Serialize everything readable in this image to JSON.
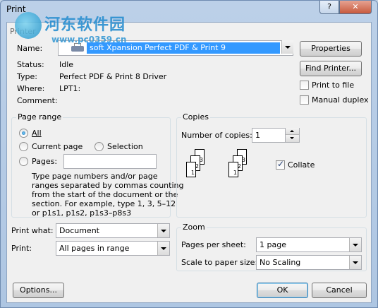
{
  "window": {
    "title": "Print",
    "help": "?",
    "close": "✕"
  },
  "watermark": {
    "title": "河东软件园",
    "url": "www.pc0359.cn"
  },
  "printer": {
    "section_label": "Printer",
    "name_label": "Name:",
    "name_value": "soft Xpansion Perfect PDF & Print 9",
    "status_label": "Status:",
    "status_value": "Idle",
    "type_label": "Type:",
    "type_value": "Perfect PDF & Print 8 Driver",
    "where_label": "Where:",
    "where_value": "LPT1:",
    "comment_label": "Comment:",
    "properties_button": "Properties",
    "find_printer_button": "Find Printer...",
    "print_to_file": "Print to file",
    "manual_duplex": "Manual duplex"
  },
  "page_range": {
    "title": "Page range",
    "all": "All",
    "current_page": "Current page",
    "selection": "Selection",
    "pages": "Pages:",
    "pages_value": "",
    "help_text_1": "Type page numbers and/or page",
    "help_text_2": "ranges separated by commas counting",
    "help_text_3": "from the start of the document or the",
    "help_text_4": "section. For example, type 1, 3, 5–12",
    "help_text_5": "or p1s1, p1s2, p1s3–p8s3"
  },
  "copies": {
    "title": "Copies",
    "number_label": "Number of copies:",
    "number_value": "1",
    "collate": "Collate",
    "collate_checked": true,
    "page_labels": [
      "1",
      "2",
      "3"
    ]
  },
  "print_what": {
    "label": "Print what:",
    "value": "Document"
  },
  "print": {
    "label": "Print:",
    "value": "All pages in range"
  },
  "zoom": {
    "title": "Zoom",
    "pages_per_sheet_label": "Pages per sheet:",
    "pages_per_sheet_value": "1 page",
    "scale_label": "Scale to paper size:",
    "scale_value": "No Scaling"
  },
  "footer": {
    "options": "Options...",
    "ok": "OK",
    "cancel": "Cancel"
  }
}
